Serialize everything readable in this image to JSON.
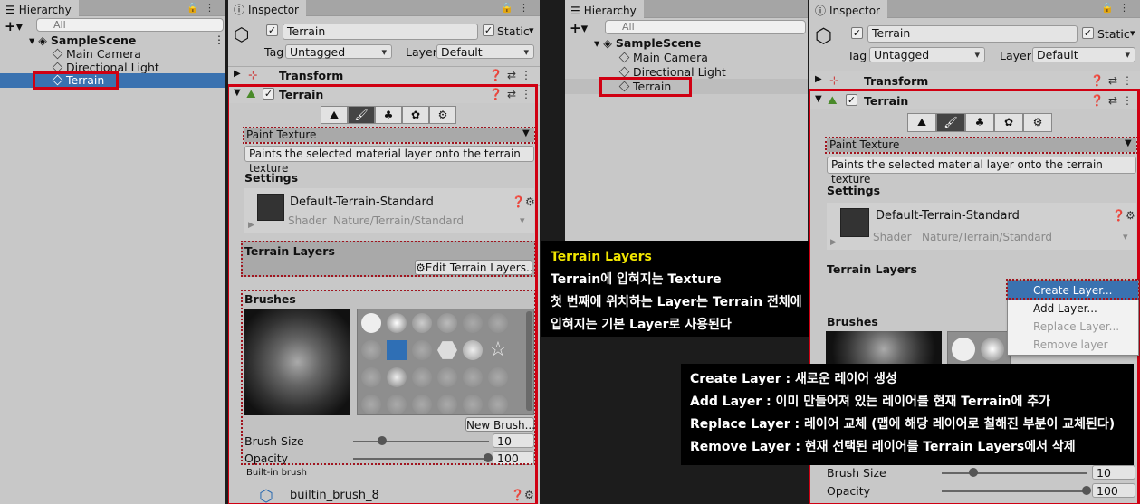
{
  "left": {
    "hierarchy": {
      "tab_label": "Hierarchy",
      "search_placeholder": "All",
      "scene": "SampleScene",
      "items": [
        "Main Camera",
        "Directional Light",
        "Terrain"
      ],
      "selected": "Terrain"
    },
    "inspector": {
      "tab_label": "Inspector",
      "object_name": "Terrain",
      "static_label": "Static",
      "tag_label": "Tag",
      "tag_value": "Untagged",
      "layer_label": "Layer",
      "layer_value": "Default",
      "components": [
        "Transform",
        "Terrain"
      ],
      "tool_mode": "Paint Texture",
      "tool_description": "Paints the selected material layer onto the terrain texture",
      "settings_label": "Settings",
      "material_name": "Default-Terrain-Standard",
      "shader_label": "Shader",
      "shader_value": "Nature/Terrain/Standard",
      "terrain_layers_label": "Terrain Layers",
      "edit_layers_button": "Edit Terrain Layers...",
      "brushes_label": "Brushes",
      "new_brush_button": "New Brush...",
      "brush_size_label": "Brush Size",
      "brush_size_value": "10",
      "opacity_label": "Opacity",
      "opacity_value": "100",
      "builtin_label": "Built-in brush",
      "brush_name": "builtin_brush_8"
    }
  },
  "right": {
    "hierarchy": {
      "tab_label": "Hierarchy",
      "search_placeholder": "All",
      "scene": "SampleScene",
      "items": [
        "Main Camera",
        "Directional Light",
        "Terrain"
      ]
    },
    "inspector": {
      "tab_label": "Inspector",
      "object_name": "Terrain",
      "static_label": "Static",
      "tag_label": "Tag",
      "tag_value": "Untagged",
      "layer_label": "Layer",
      "layer_value": "Default",
      "components": [
        "Transform",
        "Terrain"
      ],
      "tool_mode": "Paint Texture",
      "tool_description": "Paints the selected material layer onto the terrain texture",
      "settings_label": "Settings",
      "material_name": "Default-Terrain-Standard",
      "shader_label": "Shader",
      "shader_value": "Nature/Terrain/Standard",
      "terrain_layers_label": "Terrain Layers",
      "brushes_label": "Brushes",
      "brush_size_label": "Brush Size",
      "brush_size_value": "10",
      "opacity_label": "Opacity",
      "opacity_value": "100",
      "context_menu": [
        "Create Layer...",
        "Add Layer...",
        "Replace Layer...",
        "Remove layer"
      ]
    }
  },
  "captions": {
    "terrain_layers": {
      "title": "Terrain Layers",
      "lines": [
        "Terrain에 입혀지는 Texture",
        "첫 번째에 위치하는 Layer는 Terrain 전체에",
        "입혀지는 기본 Layer로 사용된다"
      ]
    },
    "layer_menu": {
      "lines": [
        "Create Layer : 새로운 레이어 생성",
        "Add Layer : 이미 만들어져 있는 레이어를 현재 Terrain에 추가",
        "Replace Layer : 레이어 교체 (맵에 해당 레이어로 칠해진 부분이 교체된다)",
        "Remove Layer : 현재 선택된 레이어를 Terrain Layers에서 삭제"
      ]
    }
  },
  "colors": {
    "highlight_box": "#d00012",
    "selection": "#3a72b0",
    "caption_title": "#f2e600"
  }
}
